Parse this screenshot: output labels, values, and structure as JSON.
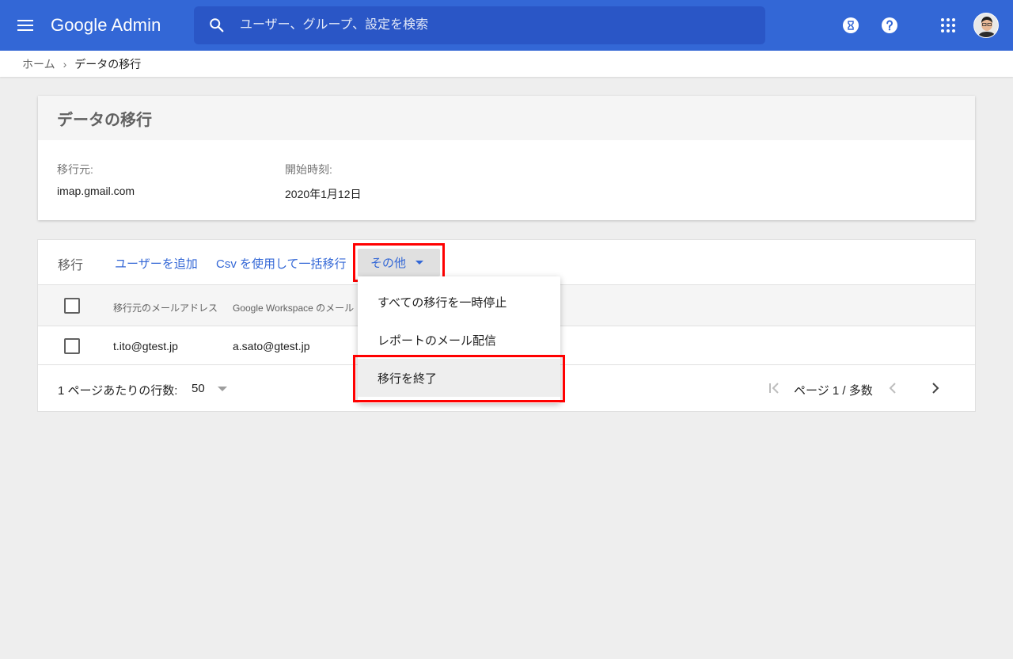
{
  "app": {
    "brand_google": "Google",
    "brand_admin": "Admin",
    "search_placeholder": "ユーザー、グループ、設定を検索",
    "colors": {
      "appbar": "#3367d6",
      "search": "#2a56c6",
      "link": "#3367d6",
      "highlight": "#ff0000"
    },
    "icons": [
      "menu-icon",
      "search-icon",
      "hourglass-icon",
      "help-icon",
      "apps-grid-icon",
      "avatar"
    ]
  },
  "breadcrumb": {
    "home": "ホーム",
    "separator": "›",
    "current": "データの移行"
  },
  "summary": {
    "title": "データの移行",
    "source_label": "移行元:",
    "source_value": "imap.gmail.com",
    "start_label": "開始時刻:",
    "start_value": "2020年1月12日"
  },
  "migration": {
    "title": "移行",
    "add_user": "ユーザーを追加",
    "bulk_csv": "Csv を使用して一括移行",
    "more": "その他",
    "columns": [
      "移行元のメールアドレス",
      "Google Workspace のメール"
    ],
    "rows": [
      {
        "source": "t.ito@gtest.jp",
        "destination": "a.sato@gtest.jp"
      }
    ],
    "rows_per_page_label": "1 ページあたりの行数:",
    "rows_per_page_value": "50",
    "pager_text": "ページ 1 / 多数"
  },
  "more_menu": {
    "items": [
      "すべての移行を一時停止",
      "レポートのメール配信",
      "移行を終了"
    ],
    "active_item": "移行を終了"
  }
}
